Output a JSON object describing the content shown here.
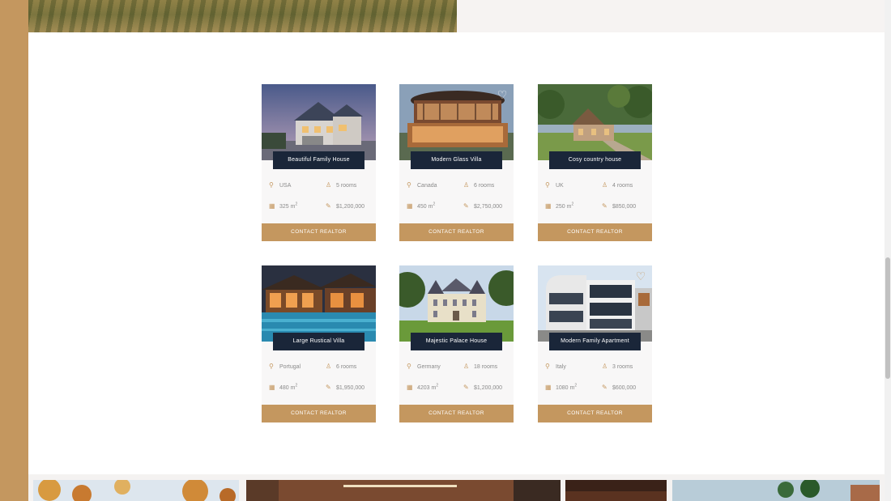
{
  "colors": {
    "accent": "#c4975f",
    "title_bg": "#1a2639",
    "card_bg": "#f8f7f7",
    "meta_text": "#8a8a8a"
  },
  "icons": {
    "location": "location-pin-icon",
    "rooms": "person-icon",
    "area": "floor-plan-icon",
    "price": "money-icon",
    "favorite": "heart-icon"
  },
  "properties": [
    {
      "title": "Beautiful Family House",
      "country": "USA",
      "rooms": "5 rooms",
      "area": "325 m",
      "area_sup": "2",
      "price": "$1,200,000",
      "button": "CONTACT REALTOR"
    },
    {
      "title": "Modern Glass Villa",
      "country": "Canada",
      "rooms": "6 rooms",
      "area": "450 m",
      "area_sup": "2",
      "price": "$2,750,000",
      "button": "CONTACT REALTOR"
    },
    {
      "title": "Cosy country house",
      "country": "UK",
      "rooms": "4 rooms",
      "area": "250 m",
      "area_sup": "2",
      "price": "$850,000",
      "button": "CONTACT REALTOR"
    },
    {
      "title": "Large Rustical Villa",
      "country": "Portugal",
      "rooms": "6 rooms",
      "area": "480 m",
      "area_sup": "2",
      "price": "$1,950,000",
      "button": "CONTACT REALTOR"
    },
    {
      "title": "Majestic Palace House",
      "country": "Germany",
      "rooms": "18 rooms",
      "area": "4203 m",
      "area_sup": "2",
      "price": "$1,200,000",
      "button": "CONTACT REALTOR"
    },
    {
      "title": "Modern Family Apartment",
      "country": "Italy",
      "rooms": "3 rooms",
      "area": "1080 m",
      "area_sup": "2",
      "price": "$600,000",
      "button": "CONTACT REALTOR"
    }
  ]
}
